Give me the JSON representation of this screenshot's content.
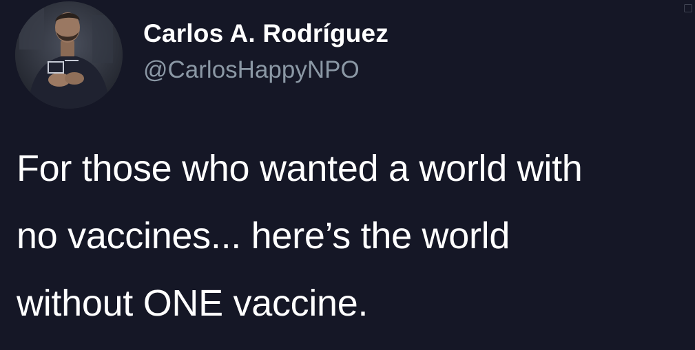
{
  "tweet": {
    "author": {
      "display_name": "Carlos A. Rodríguez",
      "handle": "@CarlosHappyNPO",
      "avatar_icon": "profile-photo"
    },
    "text_lines": [
      "For those who wanted a world with",
      "no vaccines... here’s the world",
      "without ONE vaccine."
    ]
  },
  "colors": {
    "background": "#151726",
    "name": "#ffffff",
    "handle": "#8b98a5",
    "text": "#ffffff"
  }
}
